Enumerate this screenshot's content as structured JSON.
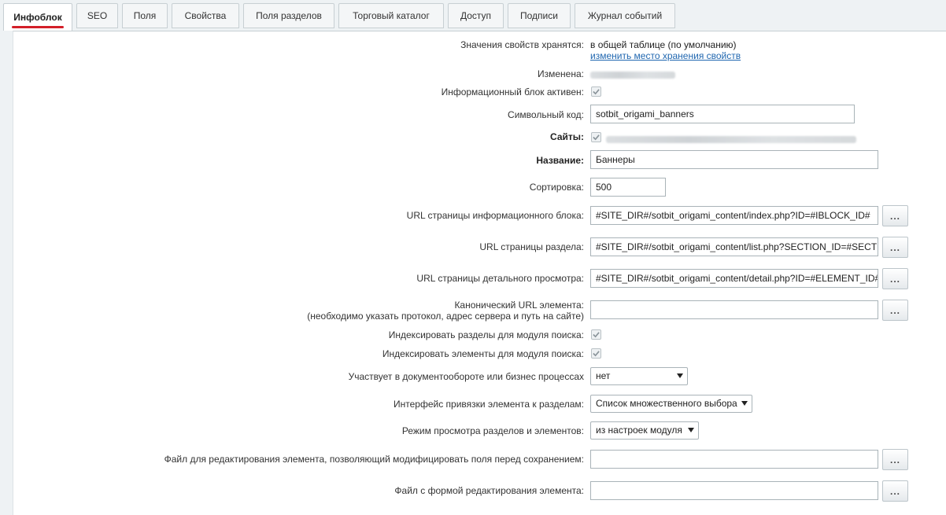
{
  "tabs": [
    {
      "label": "Инфоблок",
      "active": true
    },
    {
      "label": "SEO"
    },
    {
      "label": "Поля"
    },
    {
      "label": "Свойства"
    },
    {
      "label": "Поля разделов"
    },
    {
      "label": "Торговый каталог"
    },
    {
      "label": "Доступ"
    },
    {
      "label": "Подписи"
    },
    {
      "label": "Журнал событий"
    }
  ],
  "form": {
    "storage": {
      "label": "Значения свойств хранятся:",
      "value": "в общей таблице (по умолчанию)",
      "change_link": "изменить место хранения свойств"
    },
    "modified": {
      "label": "Изменена:"
    },
    "active": {
      "label": "Информационный блок активен:",
      "checked": true
    },
    "code": {
      "label": "Символьный код:",
      "value": "sotbit_origami_banners"
    },
    "sites": {
      "label": "Сайты:",
      "checked": true
    },
    "name": {
      "label": "Название:",
      "value": "Баннеры"
    },
    "sort": {
      "label": "Сортировка:",
      "value": "500"
    },
    "list_url": {
      "label": "URL страницы информационного блока:",
      "value": "#SITE_DIR#/sotbit_origami_content/index.php?ID=#IBLOCK_ID#"
    },
    "section_url": {
      "label": "URL страницы раздела:",
      "value": "#SITE_DIR#/sotbit_origami_content/list.php?SECTION_ID=#SECTION_ID#"
    },
    "detail_url": {
      "label": "URL страницы детального просмотра:",
      "value": "#SITE_DIR#/sotbit_origami_content/detail.php?ID=#ELEMENT_ID#"
    },
    "canonical": {
      "label_line1": "Канонический URL элемента:",
      "label_line2": "(необходимо указать протокол, адрес сервера и путь на сайте)",
      "value": ""
    },
    "index_sections": {
      "label": "Индексировать разделы для модуля поиска:",
      "checked": true
    },
    "index_elements": {
      "label": "Индексировать элементы для модуля поиска:",
      "checked": true
    },
    "workflow": {
      "label": "Участвует в документообороте или бизнес процессах",
      "selected": "нет"
    },
    "section_iface": {
      "label": "Интерфейс привязки элемента к разделам:",
      "selected": "Список множественного выбора"
    },
    "view_mode": {
      "label": "Режим просмотра разделов и элементов:",
      "selected": "из настроек модуля"
    },
    "edit_file_before": {
      "label": "Файл для редактирования элемента, позволяющий модифицировать поля перед сохранением:",
      "value": ""
    },
    "edit_form_file": {
      "label": "Файл с формой редактирования элемента:",
      "value": ""
    },
    "browse_button": "..."
  }
}
